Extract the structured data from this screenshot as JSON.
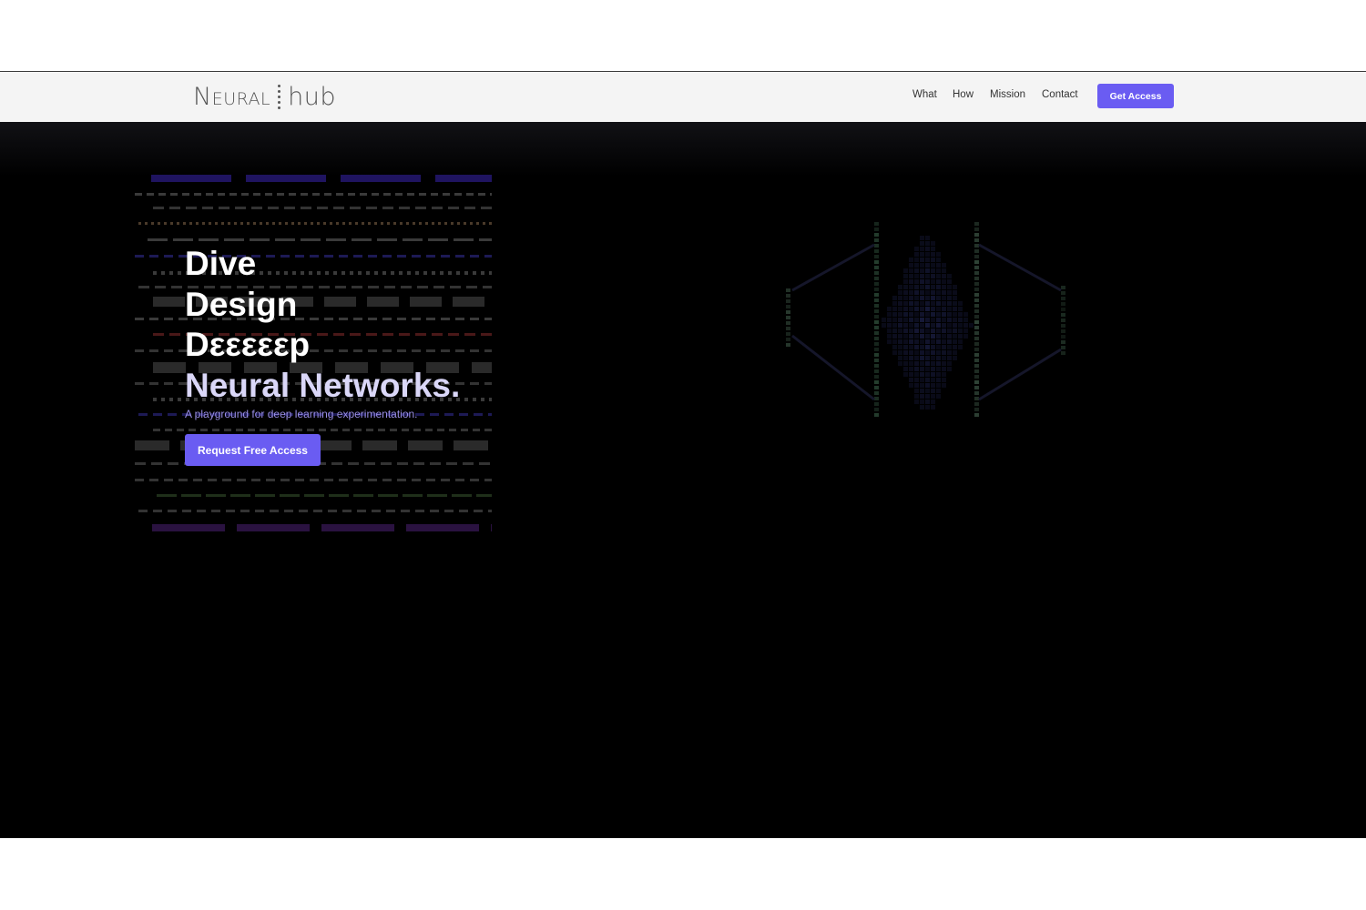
{
  "brand": {
    "logo_left": "Neural",
    "logo_right": "hub",
    "accent_color": "#6a5cf2"
  },
  "nav": {
    "links": [
      "What",
      "How",
      "Mission",
      "Contact"
    ],
    "cta_label": "Get Access"
  },
  "hero": {
    "headline": [
      "Dive",
      "Design",
      "Dεεεεεp",
      "Neural Networks."
    ],
    "subtitle": "A playground for deep learning experimentation.",
    "cta_label": "Request Free Access",
    "background_color": "#000000"
  },
  "icons": [
    "logo-dots-icon"
  ]
}
